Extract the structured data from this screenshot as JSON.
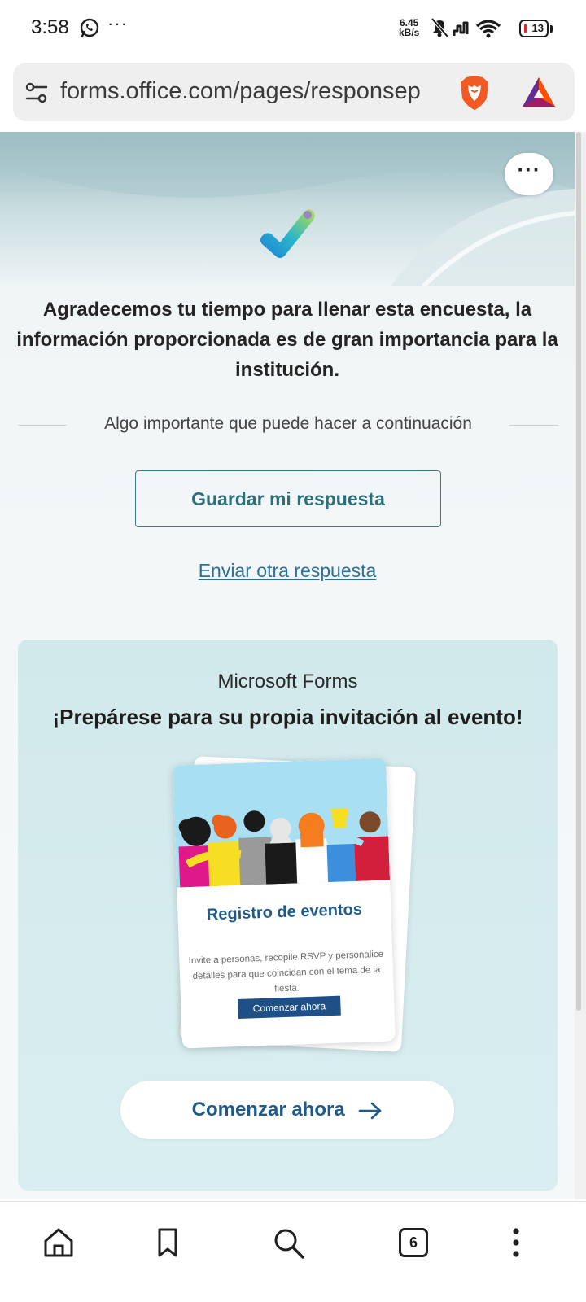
{
  "status_bar": {
    "time": "3:58",
    "dots": "···",
    "speed_value": "6.45",
    "speed_unit": "kB/s",
    "battery": "13"
  },
  "url_bar": {
    "url": "forms.office.com/pages/responsep"
  },
  "hero": {
    "more_label": "···"
  },
  "thanks_message": "Agradecemos tu tiempo para llenar esta encuesta, la información proporcionada es de gran importancia para la institución.",
  "divider_text": "Algo importante que puede hacer a continuación",
  "save_button_label": "Guardar mi respuesta",
  "send_another_label": "Enviar otra respuesta",
  "promo": {
    "brand": "Microsoft Forms",
    "title": "¡Prepárese para su propia invitación al evento!",
    "card_title": "Registro de eventos",
    "card_description": "Invite a personas, recopile RSVP y personalice detalles para que coincidan con el tema de la fiesta.",
    "card_button": "Comenzar ahora",
    "start_button": "Comenzar ahora"
  },
  "bottom_nav": {
    "tabs_count": "6"
  },
  "colors": {
    "accent_teal": "#2e6f78",
    "link_blue": "#2d6f97",
    "brand_blue": "#1f5a8a",
    "promo_bg": "#d4eaed"
  }
}
